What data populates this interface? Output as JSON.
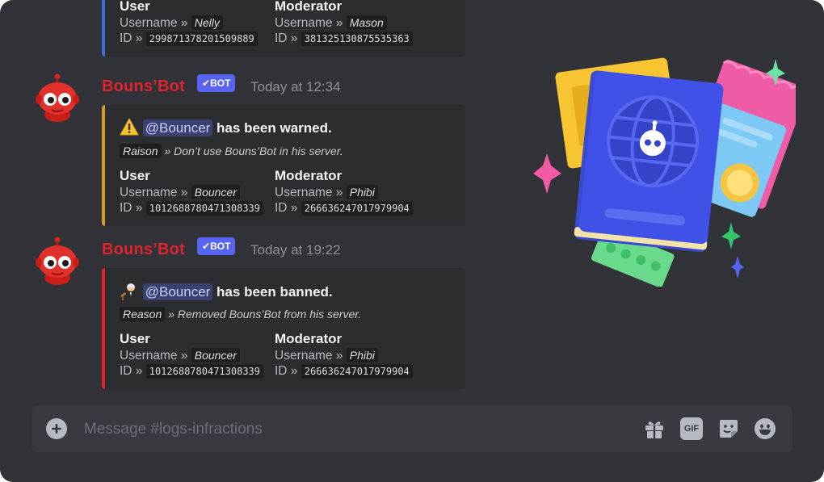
{
  "top_embed": {
    "user_header": "User",
    "user_username_key": "Username",
    "user_username_val": "Nelly",
    "user_id_key": "ID",
    "user_id_val": "299871378201509889",
    "mod_header": "Moderator",
    "mod_username_key": "Username",
    "mod_username_val": "Mason",
    "mod_id_key": "ID",
    "mod_id_val": "381325130875535363",
    "bar_color": "#3f6fd9"
  },
  "messages": [
    {
      "author": "Bouns’Bot",
      "bot_tag": "BOT",
      "timestamp": "Today at 12:34",
      "emoji": "warning-icon",
      "mention": "@Bouncer",
      "action": "has been warned.",
      "reason_key": "Raison",
      "reason_text": "» Don’t use Bouns’Bot in his server.",
      "user_header": "User",
      "user_username_key": "Username",
      "user_username_val": "Bouncer",
      "user_id_key": "ID",
      "user_id_val": "1012688780471308339",
      "mod_header": "Moderator",
      "mod_username_key": "Username",
      "mod_username_val": "Phibi",
      "mod_id_key": "ID",
      "mod_id_val": "266636247017979904",
      "bar_color": "#d99a2b"
    },
    {
      "author": "Bouns’Bot",
      "bot_tag": "BOT",
      "timestamp": "Today at 19:22",
      "emoji": "judge-icon",
      "mention": "@Bouncer",
      "action": "has been banned.",
      "reason_key": "Reason",
      "reason_text": "» Removed Bouns’Bot from his server.",
      "user_header": "User",
      "user_username_key": "Username",
      "user_username_val": "Bouncer",
      "user_id_key": "ID",
      "user_id_val": "1012688780471308339",
      "mod_header": "Moderator",
      "mod_username_key": "Username",
      "mod_username_val": "Phibi",
      "mod_id_key": "ID",
      "mod_id_val": "266636247017979904",
      "bar_color": "#e0242f"
    }
  ],
  "composer": {
    "placeholder": "Message #logs-infractions",
    "add_icon": "plus-circle-icon",
    "gift_icon": "gift-icon",
    "gif_label": "GIF",
    "sticker_icon": "sticker-icon",
    "emoji_icon": "emoji-icon"
  },
  "colors": {
    "background": "#313338",
    "embed": "#2b2d31",
    "author": "#e0242f",
    "bot_tag": "#5865f2",
    "composer": "#383a40"
  }
}
